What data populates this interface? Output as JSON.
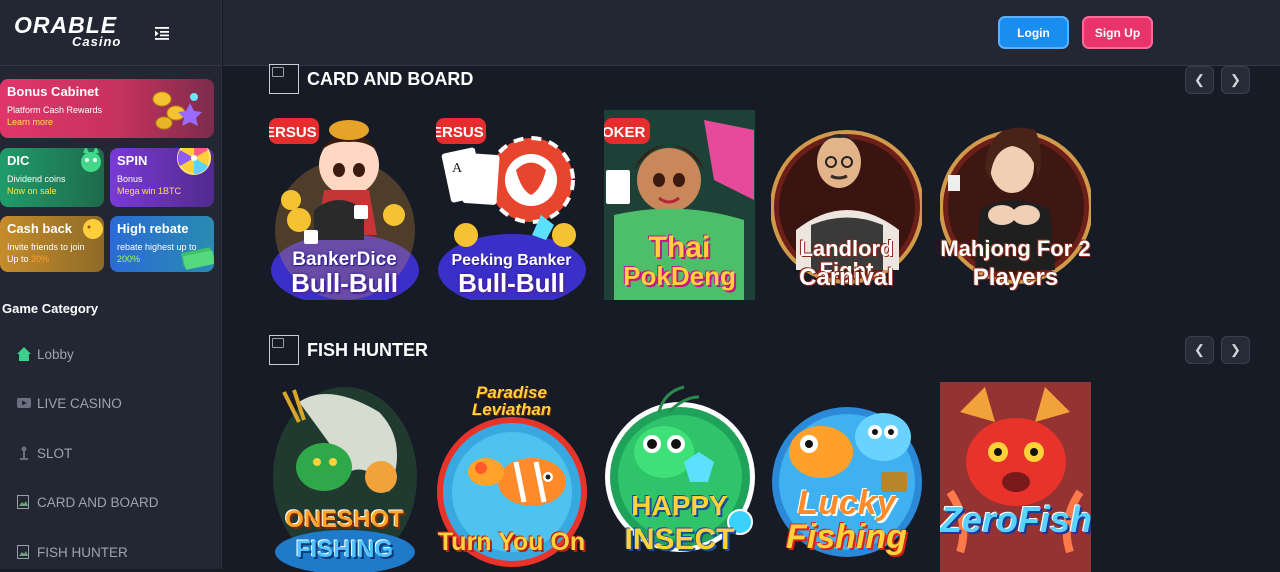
{
  "brand": {
    "name": "ORABLE",
    "sub": "Casino"
  },
  "header": {
    "login": "Login",
    "signup": "Sign Up"
  },
  "promos": {
    "bonus": {
      "title": "Bonus Cabinet",
      "line1": "Platform Cash Rewards",
      "line2": "Learn more"
    },
    "dic": {
      "title": "DIC",
      "line1": "Dividend coins",
      "line2": "Now on sale"
    },
    "spin": {
      "title": "SPIN",
      "line1": "Bonus",
      "line2": "Mega win 1BTC"
    },
    "cashback": {
      "title": "Cash back",
      "line1": "Invite friends to join",
      "line2_prefix": "Up to ",
      "line2_value": "20%"
    },
    "rebate": {
      "title": "High rebate",
      "line1": "rebate highest up to",
      "line2": "200%"
    }
  },
  "sidebar": {
    "category_title": "Game Category",
    "items": [
      {
        "label": "Lobby",
        "icon": "home-icon"
      },
      {
        "label": "LIVE CASINO",
        "icon": "video-icon"
      },
      {
        "label": "SLOT",
        "icon": "slot-icon"
      },
      {
        "label": "CARD AND BOARD",
        "icon": "broken-image-icon"
      },
      {
        "label": "FISH HUNTER",
        "icon": "broken-image-icon"
      }
    ]
  },
  "sections": [
    {
      "title": "CARD AND BOARD",
      "games": [
        {
          "line1": "BankerDice",
          "line2": "Bull-Bull",
          "badge": "ERSUS"
        },
        {
          "line1": "Peeking Banker",
          "line2": "Bull-Bull",
          "badge": "ERSUS"
        },
        {
          "line1": "Thai",
          "line2": "PokDeng",
          "badge": "OKER"
        },
        {
          "line1": "Landlord Fight",
          "line2": "Carnival",
          "badge": ""
        },
        {
          "line1": "Mahjong For 2",
          "line2": "Players",
          "badge": ""
        }
      ]
    },
    {
      "title": "FISH HUNTER",
      "games": [
        {
          "line1": "ONESHOT",
          "line2": "FISHING",
          "top": ""
        },
        {
          "line1": "Turn You On",
          "line2": "",
          "top": "Paradise Leviathan"
        },
        {
          "line1": "HAPPY",
          "line2": "INSECT",
          "top": ""
        },
        {
          "line1": "Lucky",
          "line2": "Fishing",
          "top": ""
        },
        {
          "line1": "Zero",
          "line2": "Fishing",
          "top": ""
        }
      ]
    }
  ],
  "colors": {
    "accent_login": "#1a8df0",
    "accent_signup": "#e8336b",
    "bg": "#171b26",
    "sidebar": "#232733"
  }
}
